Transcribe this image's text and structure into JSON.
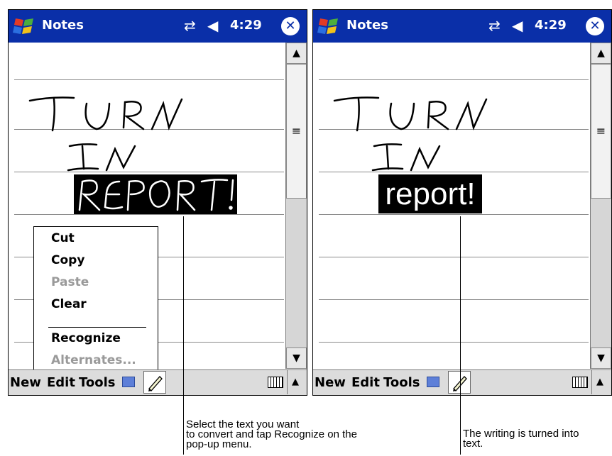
{
  "screens": {
    "left": {
      "app_title": "Notes",
      "clock": "4:29",
      "toolbar": {
        "new": "New",
        "edit": "Edit",
        "tools": "Tools"
      },
      "context_menu": {
        "items": [
          "Cut",
          "Copy",
          "Paste",
          "Clear",
          "Recognize",
          "Alternates..."
        ],
        "disabled": [
          "Paste",
          "Alternates..."
        ]
      },
      "ink_note": "TURN IN REPORT!"
    },
    "right": {
      "app_title": "Notes",
      "clock": "4:29",
      "toolbar": {
        "new": "New",
        "edit": "Edit",
        "tools": "Tools"
      },
      "ink_note": "TURN IN",
      "recognized_text": "report!"
    }
  },
  "callouts": {
    "left": "Select the text you want\nto convert and tap Recognize on the\npop-up menu.",
    "right": "The writing is turned into\ntext."
  },
  "icons": [
    "windows-logo-icon",
    "connectivity-icon",
    "volume-icon",
    "close-icon",
    "keyboard-icon",
    "pen-icon",
    "scroll-up-icon",
    "scroll-down-icon",
    "sip-arrow-icon"
  ],
  "colors": {
    "titlebar": "#0a2fa8",
    "menubar": "#dcdcdc",
    "selection": "#000000"
  }
}
